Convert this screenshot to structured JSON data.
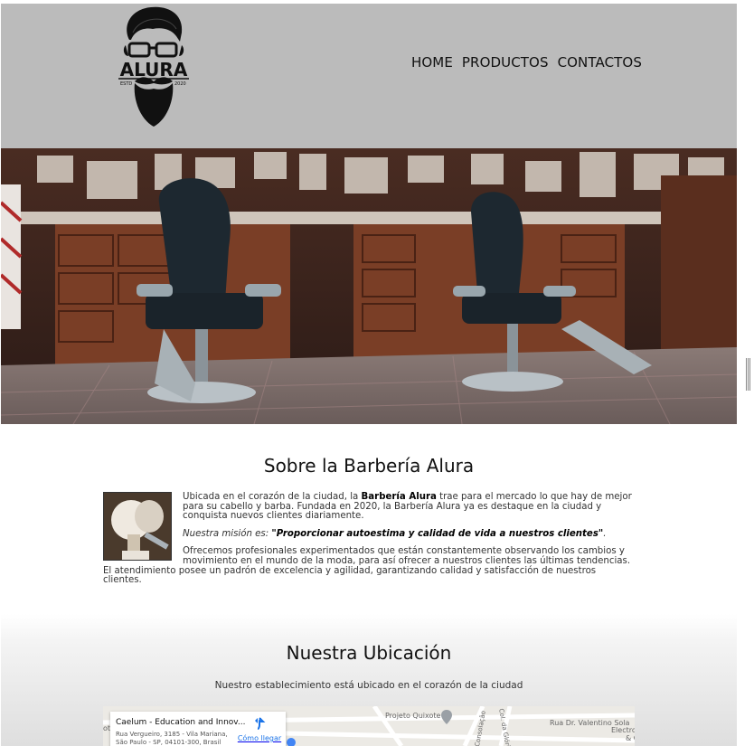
{
  "header": {
    "logo": {
      "name": "ALURA",
      "est_left": "ESTD",
      "est_right": "2020"
    },
    "nav": [
      "HOME",
      "PRODUCTOS",
      "CONTACTOS"
    ]
  },
  "about": {
    "title": "Sobre la Barbería Alura",
    "p1_a": "Ubicada en el corazón de la ciudad, la ",
    "p1_b": "Barbería Alura",
    "p1_c": " trae para el mercado lo que hay de mejor para su cabello y barba. Fundada en 2020, la Barbería Alura ya es destaque en la ciudad y conquista nuevos clientes diariamente.",
    "p2_a": "Nuestra misión es: ",
    "p2_b": "\"Proporcionar autoestima y calidad de vida a nuestros clientes\"",
    "p2_c": ".",
    "p3": "Ofrecemos profesionales experimentados que están constantemente observando los cambios y movimiento en el mundo de la moda, para así ofrecer a nuestros clientes las últimas tendencias. El atendimiento posee un padrón de excelencia y agilidad, garantizando calidad y satisfacción de nuestros clientes."
  },
  "location": {
    "title": "Nuestra Ubicación",
    "subtitle": "Nuestro establecimiento está ubicado en el corazón de la ciudad",
    "map": {
      "place_title": "Caelum - Education and Innov...",
      "address_line1": "Rua Vergueiro, 3185 - Vila Mariana,",
      "address_line2": "São Paulo - SP, 04101-300, Brasil",
      "directions": "Cómo llegar",
      "labels": [
        "Projeto Quixote",
        "Col. da Glória",
        "Rua Dr. Valentino Sola",
        "Electro",
        "& C",
        "Consolação",
        "ot"
      ]
    }
  },
  "colors": {
    "header_bg": "#bbbbbb",
    "link_blue": "#1a73e8"
  }
}
